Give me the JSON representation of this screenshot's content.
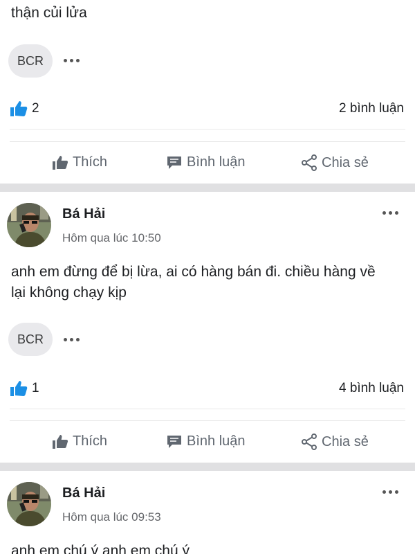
{
  "post0": {
    "text_tail": "thận củi lửa",
    "reaction_chip": "BCR",
    "like_count": "2",
    "comments": "2 bình luận"
  },
  "post1": {
    "author": "Bá Hải",
    "time": "Hôm qua lúc 10:50",
    "text": "anh em đừng để bị lừa, ai có hàng bán đi. chiều hàng về lại không chạy kịp",
    "reaction_chip": "BCR",
    "like_count": "1",
    "comments": "4 bình luận"
  },
  "post2": {
    "author": "Bá Hải",
    "time": "Hôm qua lúc 09:53",
    "text": "anh em chú ý anh em chú ý"
  },
  "actions": {
    "like": "Thích",
    "comment": "Bình luận",
    "share": "Chia sẻ"
  },
  "icons": {
    "like": "thumbs-up-icon",
    "comment": "comment-icon",
    "share": "share-icon",
    "more": "more-dots-icon",
    "reactions": "blue-thumbs-up-icon"
  },
  "colors": {
    "accent": "#1877f2",
    "action_text": "#606770",
    "divider": "#e0e0e2"
  }
}
